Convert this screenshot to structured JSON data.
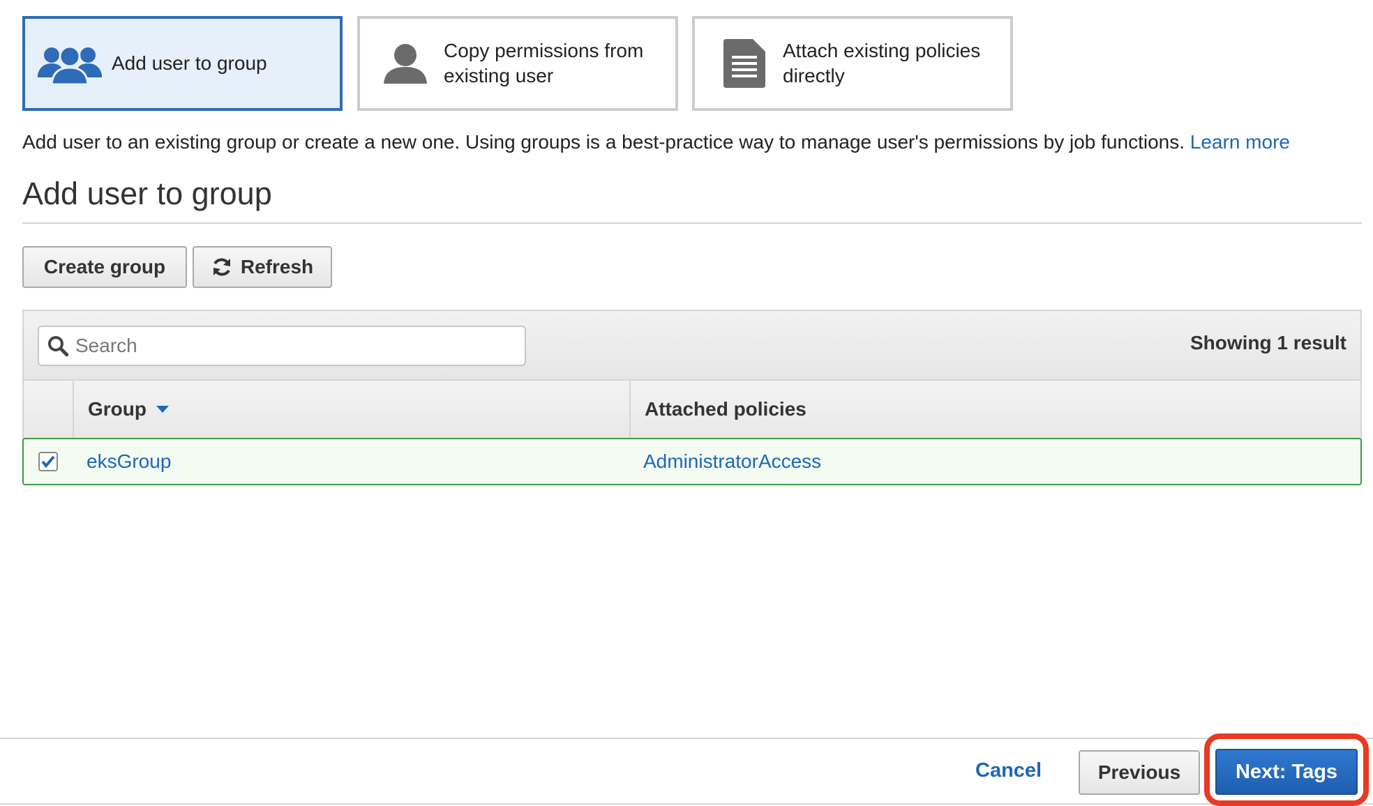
{
  "options": {
    "add_to_group": "Add user to group",
    "copy_permissions_line1": "Copy permissions from",
    "copy_permissions_line2": "existing user",
    "attach_policies_line1": "Attach existing policies",
    "attach_policies_line2": "directly"
  },
  "description": {
    "text": "Add user to an existing group or create a new one. Using groups is a best-practice way to manage user's permissions by job functions.",
    "link": "Learn more"
  },
  "section_title": "Add user to group",
  "buttons": {
    "create_group": "Create group",
    "refresh": "Refresh"
  },
  "table": {
    "search_placeholder": "Search",
    "result_count": "Showing 1 result",
    "columns": [
      "Group",
      "Attached policies"
    ],
    "rows": [
      {
        "group": "eksGroup",
        "policies": "AdministratorAccess",
        "checked": true
      }
    ]
  },
  "footer": {
    "cancel": "Cancel",
    "previous": "Previous",
    "next": "Next: Tags"
  },
  "colors": {
    "accent": "#1f66b7",
    "selected_bg": "#e6f0fb",
    "row_border": "#3c9a45",
    "highlight": "#e83a24"
  },
  "icons": [
    "group-icon",
    "user-icon",
    "document-icon",
    "refresh-icon",
    "search-icon",
    "sort-caret-icon",
    "checkmark-icon"
  ]
}
